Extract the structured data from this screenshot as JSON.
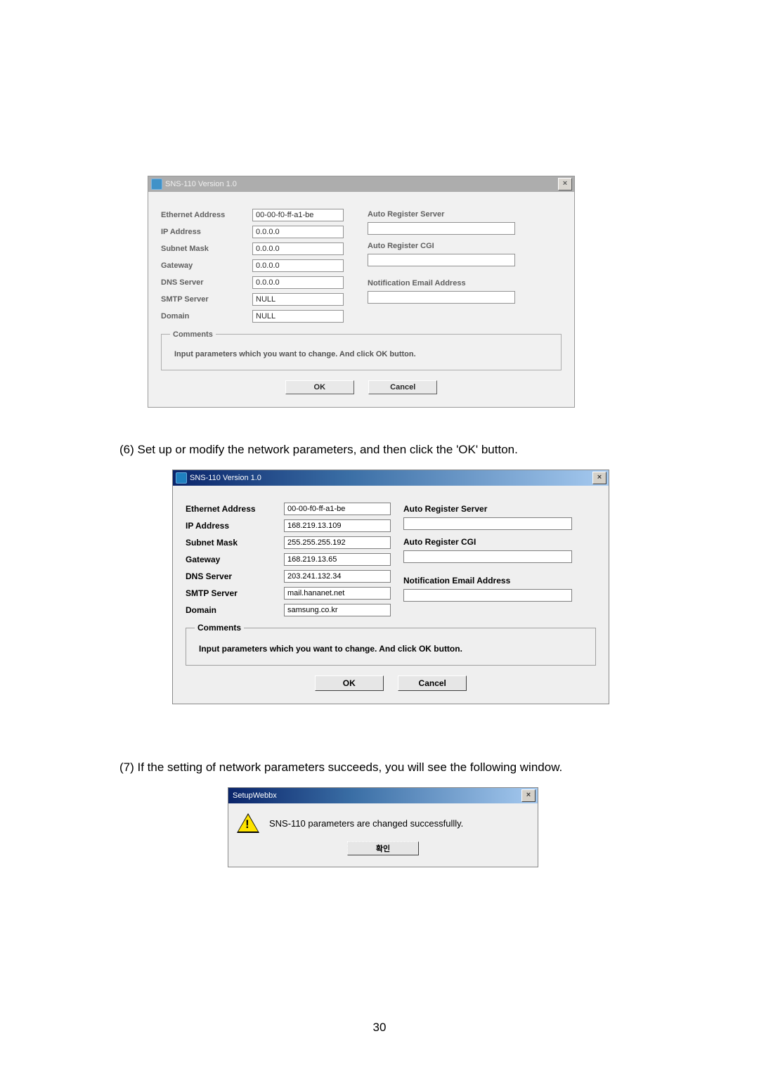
{
  "screenshot1": {
    "title": "SNS-110 Version 1.0",
    "close_x": "×",
    "left": {
      "eth_label": "Ethernet Address",
      "eth_value": "00-00-f0-ff-a1-be",
      "ip_label": "IP Address",
      "ip_value": "0.0.0.0",
      "sn_label": "Subnet Mask",
      "sn_value": "0.0.0.0",
      "gw_label": "Gateway",
      "gw_value": "0.0.0.0",
      "dns_label": "DNS Server",
      "dns_value": "0.0.0.0",
      "smtp_label": "SMTP Server",
      "smtp_value": "NULL",
      "dom_label": "Domain",
      "dom_value": "NULL"
    },
    "right": {
      "ars_label": "Auto Register Server",
      "ars_value": "",
      "arc_label": "Auto Register CGI",
      "arc_value": "",
      "nea_label": "Notification Email Address",
      "nea_value": ""
    },
    "comments_label": "Comments",
    "comments_text": "Input parameters which you want to change. And click OK button.",
    "ok_label": "OK",
    "cancel_label": "Cancel"
  },
  "step6": "(6) Set up or modify the network parameters, and then click the 'OK' button.",
  "screenshot2": {
    "title": "SNS-110 Version 1.0",
    "close_x": "×",
    "left": {
      "eth_label": "Ethernet Address",
      "eth_value": "00-00-f0-ff-a1-be",
      "ip_label": "IP Address",
      "ip_value": "168.219.13.109",
      "sn_label": "Subnet Mask",
      "sn_value": "255.255.255.192",
      "gw_label": "Gateway",
      "gw_value": "168.219.13.65",
      "dns_label": "DNS Server",
      "dns_value": "203.241.132.34",
      "smtp_label": "SMTP Server",
      "smtp_value": "mail.hananet.net",
      "dom_label": "Domain",
      "dom_value": "samsung.co.kr"
    },
    "right": {
      "ars_label": "Auto Register Server",
      "ars_value": "",
      "arc_label": "Auto Register CGI",
      "arc_value": "",
      "nea_label": "Notification Email Address",
      "nea_value": ""
    },
    "comments_label": "Comments",
    "comments_text": "Input parameters which you want to change. And click OK button.",
    "ok_label": "OK",
    "cancel_label": "Cancel"
  },
  "step7": "(7) If the setting of network parameters succeeds, you will see the following window.",
  "screenshot3": {
    "title": "SetupWebbx",
    "close_x": "×",
    "message": "SNS-110 parameters are changed successfullly.",
    "ok_label": "확인"
  },
  "page_number": "30"
}
